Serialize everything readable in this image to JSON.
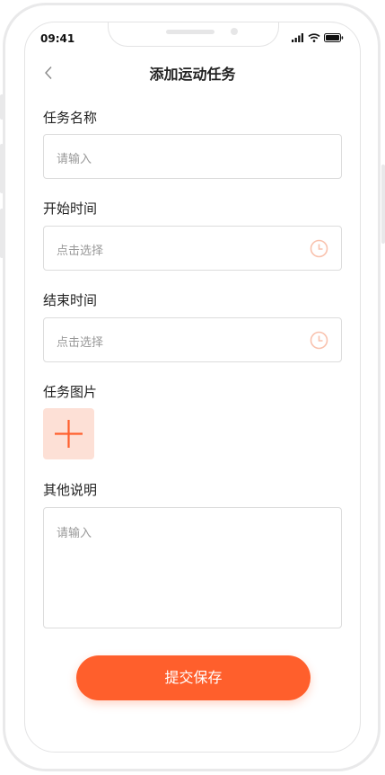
{
  "status_bar": {
    "time": "09:41"
  },
  "header": {
    "title": "添加运动任务"
  },
  "form": {
    "task_name": {
      "label": "任务名称",
      "placeholder": "请输入"
    },
    "start_time": {
      "label": "开始时间",
      "placeholder": "点击选择"
    },
    "end_time": {
      "label": "结束时间",
      "placeholder": "点击选择"
    },
    "task_image": {
      "label": "任务图片"
    },
    "notes": {
      "label": "其他说明",
      "placeholder": "请输入"
    }
  },
  "submit": {
    "label": "提交保存"
  },
  "colors": {
    "accent": "#ff5f2c",
    "upload_bg": "#fde0d6",
    "clock_icon": "#f9c2ae"
  },
  "icons": [
    "back-chevron-icon",
    "signal-icon",
    "wifi-icon",
    "battery-icon",
    "clock-icon",
    "plus-icon"
  ]
}
